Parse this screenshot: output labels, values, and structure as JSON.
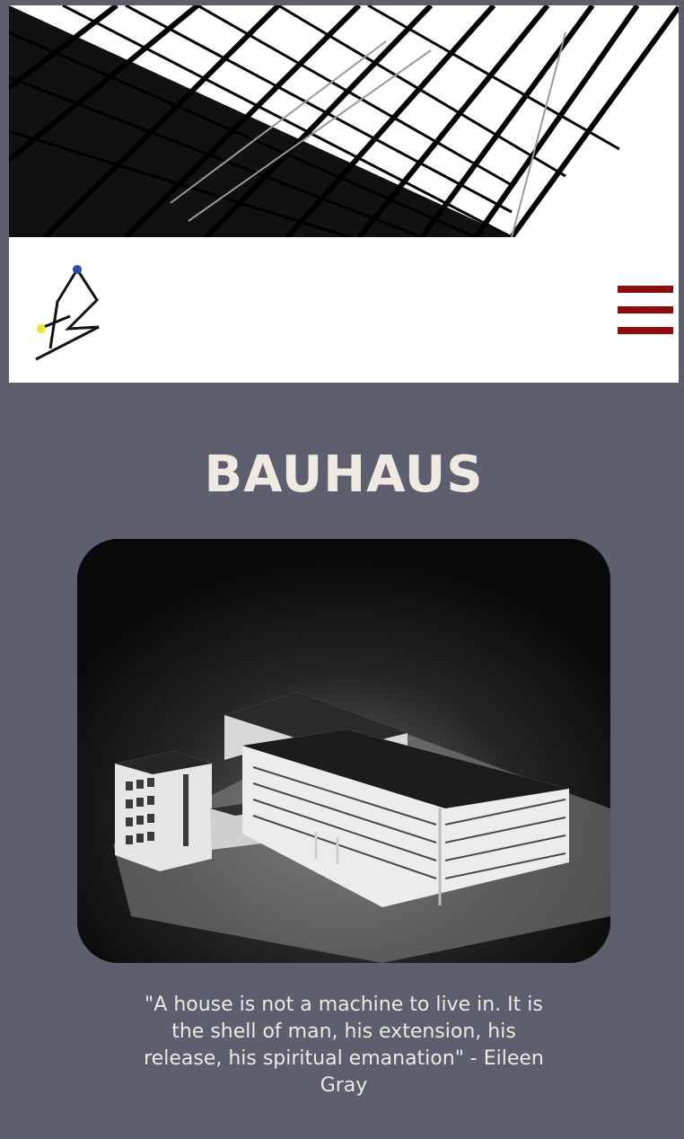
{
  "header": {
    "logo_icon": "bauhaus-logo-icon",
    "menu_icon": "hamburger-menu-icon",
    "menu_color": "#8b0e0c"
  },
  "hero": {
    "icon": "architecture-lines-image"
  },
  "main": {
    "title": "BAUHAUS",
    "image_icon": "bauhaus-building-model-image",
    "quote": "\"A house is not a machine to live in. It is the shell of man, his extension, his release, his spiritual emanation\" - Eileen Gray"
  },
  "colors": {
    "background": "#5d5e6e",
    "title": "#eeeae2",
    "accent": "#8b0e0c"
  }
}
